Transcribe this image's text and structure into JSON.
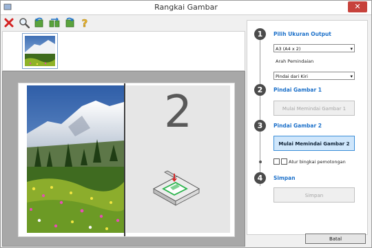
{
  "window": {
    "title": "Rangkai Gambar",
    "close_glyph": "✕"
  },
  "toolbar": {
    "items": [
      {
        "name": "delete-icon"
      },
      {
        "name": "zoom-icon"
      },
      {
        "name": "rotate-left-icon"
      },
      {
        "name": "swap-icon"
      },
      {
        "name": "rotate-right-icon"
      },
      {
        "name": "help-icon",
        "glyph": "?"
      }
    ]
  },
  "preview": {
    "placeholder_number": "2"
  },
  "steps": {
    "step1": {
      "number": "1",
      "label": "Pilih Ukuran Output",
      "output_size": "A3 (A4 x 2)",
      "direction_label": "Arah Pemindaian",
      "direction": "Pindai dari Kiri"
    },
    "step2": {
      "number": "2",
      "label": "Pindai Gambar 1",
      "button": "Mulai Memindai Gambar 1"
    },
    "step3": {
      "number": "3",
      "label": "Pindai Gambar 2",
      "button": "Mulai Memindai Gambar 2",
      "checkbox_label": "Atur bingkai pemotongan"
    },
    "step4": {
      "number": "4",
      "label": "Simpan",
      "button": "Simpan"
    }
  },
  "footer": {
    "cancel": "Batal"
  },
  "colors": {
    "accent": "#1a6fc9",
    "active_button": "#cfe6fb",
    "close": "#c7423b"
  }
}
